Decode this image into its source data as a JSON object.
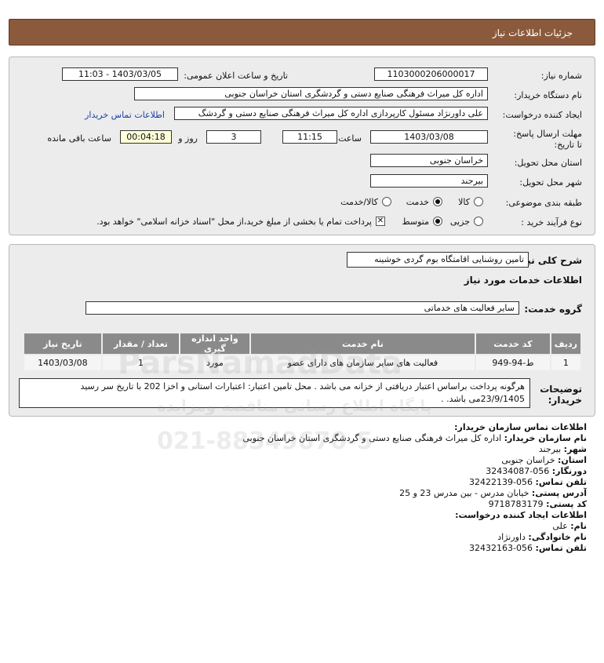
{
  "header": {
    "title": "جزئیات اطلاعات نیاز"
  },
  "info": {
    "need_number_label": "شماره نیاز:",
    "need_number": "1103000206000017",
    "announce_label": "تاریخ و ساعت اعلان عمومی:",
    "announce_value": "1403/03/05 - 11:03",
    "buyer_org_label": "نام دستگاه خریدار:",
    "buyer_org": "اداره کل میراث فرهنگی  صنایع دستی و گردشگری استان خراسان جنوبی",
    "creator_label": "ایجاد کننده درخواست:",
    "creator": "علی داورنژاد مسئول کارپردازی اداره کل میراث فرهنگی  صنایع دستی و گردشگ",
    "contact_link": "اطلاعات تماس خریدار",
    "deadline_label": "مهلت ارسال پاسخ: تا تاریخ:",
    "deadline_date": "1403/03/08",
    "time_label": "ساعت",
    "deadline_time": "11:15",
    "days_value": "3",
    "days_label": "روز و",
    "remaining_time": "00:04:18",
    "remaining_label": "ساعت باقی مانده",
    "province_label": "استان محل تحویل:",
    "province": "خراسان جنوبی",
    "city_label": "شهر محل تحویل:",
    "city": "بیرجند",
    "category_label": "طبقه بندی موضوعی:",
    "category_options": [
      "کالا",
      "خدمت",
      "کالا/خدمت"
    ],
    "category_selected": "خدمت",
    "process_label": "نوع فرآیند خرید :",
    "process_options": [
      "جزیی",
      "متوسط"
    ],
    "process_selected": "متوسط",
    "payment_note": "پرداخت تمام یا بخشی از مبلغ خرید،از محل \"اسناد خزانه اسلامی\" خواهد بود."
  },
  "need": {
    "summary_label": "شرح کلی نیاز:",
    "summary": "تامین روشنایی اقامتگاه بوم گردی خوشینه",
    "services_title": "اطلاعات خدمات مورد نیاز",
    "group_label": "گروه خدمت:",
    "group_value": "سایر فعالیت های خدماتی",
    "table_headers": [
      "ردیف",
      "کد خدمت",
      "نام خدمت",
      "واحد اندازه گیری",
      "تعداد / مقدار",
      "تاریخ نیاز"
    ],
    "table_rows": [
      [
        "1",
        "ط-94-949",
        "فعالیت های سایر سازمان های دارای عضو",
        "مورد",
        "1",
        "1403/03/08"
      ]
    ],
    "buyer_notes_label": "توضیحات خریدار:",
    "buyer_notes": "هرگونه پرداخت براساس اعتبار دریافتی از خزانه می باشد . محل تامین اعتبار: اعتبارات استانی و اخزا 202 با تاریخ سر رسید 23/9/1405می باشد. ."
  },
  "contact": {
    "buyer_title": "اطلاعات تماس سازمان خریدار:",
    "org_name_label": "نام سازمان خریدار:",
    "org_name": "اداره کل میراث فرهنگی صنایع دستی و گردشگری استان خراسان جنوبی",
    "city_label": "شهر:",
    "city": "بیرجند",
    "province_label": "استان:",
    "province": "خراسان جنوبی",
    "fax_label": "دورنگار:",
    "fax": "056-32434087",
    "phone_label": "تلفن تماس:",
    "phone": "056-32422139",
    "address_label": "آدرس پستی:",
    "address": "خیابان مدرس - بین مدرس 23 و 25",
    "postal_label": "کد پستی:",
    "postal": "9718783179",
    "creator_title": "اطلاعات ایجاد کننده درخواست:",
    "name_label": "نام:",
    "name": "علی",
    "family_label": "نام خانوادگی:",
    "family": "داورنژاد",
    "creator_phone_label": "تلفن تماس:",
    "creator_phone": "056-32432163"
  },
  "watermark": {
    "brand": "ParsNamadData",
    "phone": "021-88349670-5",
    "slogan": "پایگاه اطلاع رسانی مناقصه ومزایده"
  }
}
